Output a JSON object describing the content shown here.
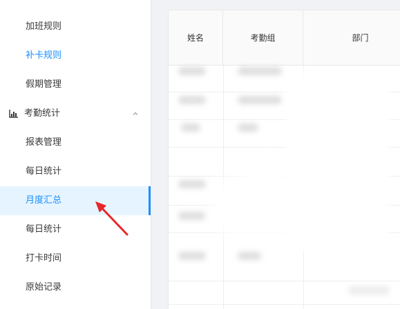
{
  "sidebar": {
    "items": [
      {
        "label": "加班规则"
      },
      {
        "label": "补卡规则"
      },
      {
        "label": "假期管理"
      }
    ],
    "group": {
      "label": "考勤统计",
      "icon": "bar-chart-icon",
      "chevron": "chevron-up-icon"
    },
    "sub_items": [
      {
        "label": "报表管理"
      },
      {
        "label": "每日统计"
      },
      {
        "label": "月度汇总"
      },
      {
        "label": "每日统计"
      },
      {
        "label": "打卡时间"
      },
      {
        "label": "原始记录"
      }
    ],
    "selected_index": 2
  },
  "table": {
    "headers": [
      "姓名",
      "考勤组",
      "部门"
    ]
  },
  "colors": {
    "accent": "#1890ff",
    "selected_bg": "#e6f4ff",
    "arrow": "#e8262a"
  }
}
